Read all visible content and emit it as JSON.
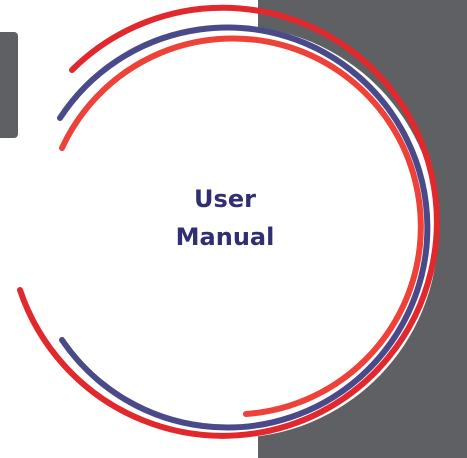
{
  "cover": {
    "title_line1": "User",
    "title_line2": "Manual"
  },
  "colors": {
    "panel_gray": "#5f6064",
    "arc_red": "#e0282d",
    "arc_blue": "#4a4a8a",
    "arc_coral": "#ee4138",
    "title_color": "#2f2f72"
  }
}
